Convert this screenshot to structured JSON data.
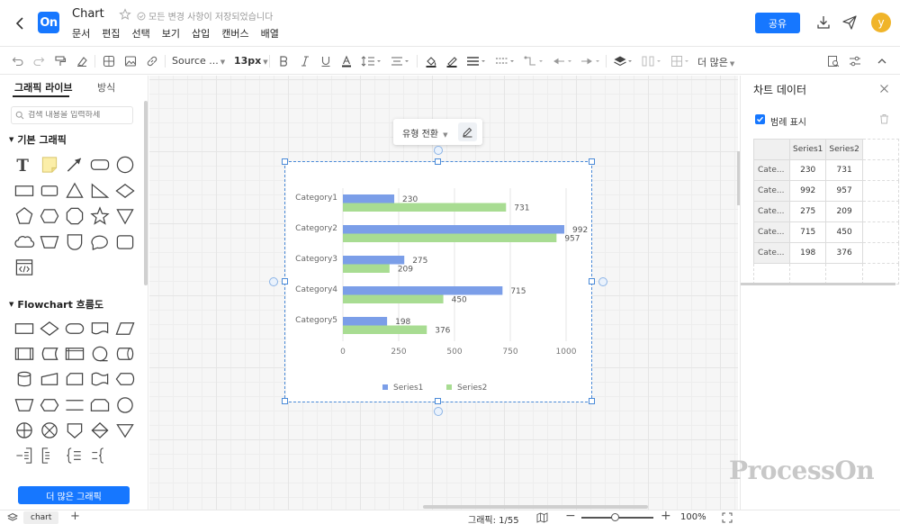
{
  "header": {
    "logo_text": "On",
    "title": "Chart",
    "saved_status": "모든 변경 사항이 저장되었습니다",
    "menu": [
      "문서",
      "편집",
      "선택",
      "보기",
      "삽입",
      "캔버스",
      "배열"
    ],
    "share_label": "공유",
    "avatar_initial": "y"
  },
  "toolbar": {
    "font_family": "Source ...",
    "font_size": "13px",
    "more_label": "더 많은"
  },
  "left_panel": {
    "tabs": [
      "그래픽 라이브",
      "방식"
    ],
    "search_placeholder": "검색 내용을 입력하세",
    "sections": [
      "기본 그래픽",
      "Flowchart 흐름도"
    ],
    "more_button": "더 많은 그래픽"
  },
  "canvas": {
    "type_switch_label": "유형 전환"
  },
  "chart_data": {
    "type": "bar",
    "orientation": "horizontal",
    "categories": [
      "Category1",
      "Category2",
      "Category3",
      "Category4",
      "Category5"
    ],
    "series": [
      {
        "name": "Series1",
        "values": [
          230,
          992,
          275,
          715,
          198
        ],
        "color": "#7b9ee8"
      },
      {
        "name": "Series2",
        "values": [
          731,
          957,
          209,
          450,
          376
        ],
        "color": "#a8dc92"
      }
    ],
    "xlim": [
      0,
      1000
    ],
    "xticks": [
      "0",
      "250",
      "500",
      "750",
      "1000"
    ],
    "grid": true,
    "legend": "bottom-center"
  },
  "right_panel": {
    "title": "차트 데이터",
    "legend_toggle_label": "범례 표시",
    "legend_checked": true,
    "table": {
      "headers": [
        "Series1",
        "Series2"
      ],
      "rows": [
        {
          "label": "Cate...",
          "values": [
            "230",
            "731"
          ]
        },
        {
          "label": "Cate...",
          "values": [
            "992",
            "957"
          ]
        },
        {
          "label": "Cate...",
          "values": [
            "275",
            "209"
          ]
        },
        {
          "label": "Cate...",
          "values": [
            "715",
            "450"
          ]
        },
        {
          "label": "Cate...",
          "values": [
            "198",
            "376"
          ]
        }
      ]
    }
  },
  "watermark": "ProcessOn",
  "status_bar": {
    "sheet_name": "chart",
    "shape_count": "그래픽: 1/55",
    "zoom": "100%"
  }
}
